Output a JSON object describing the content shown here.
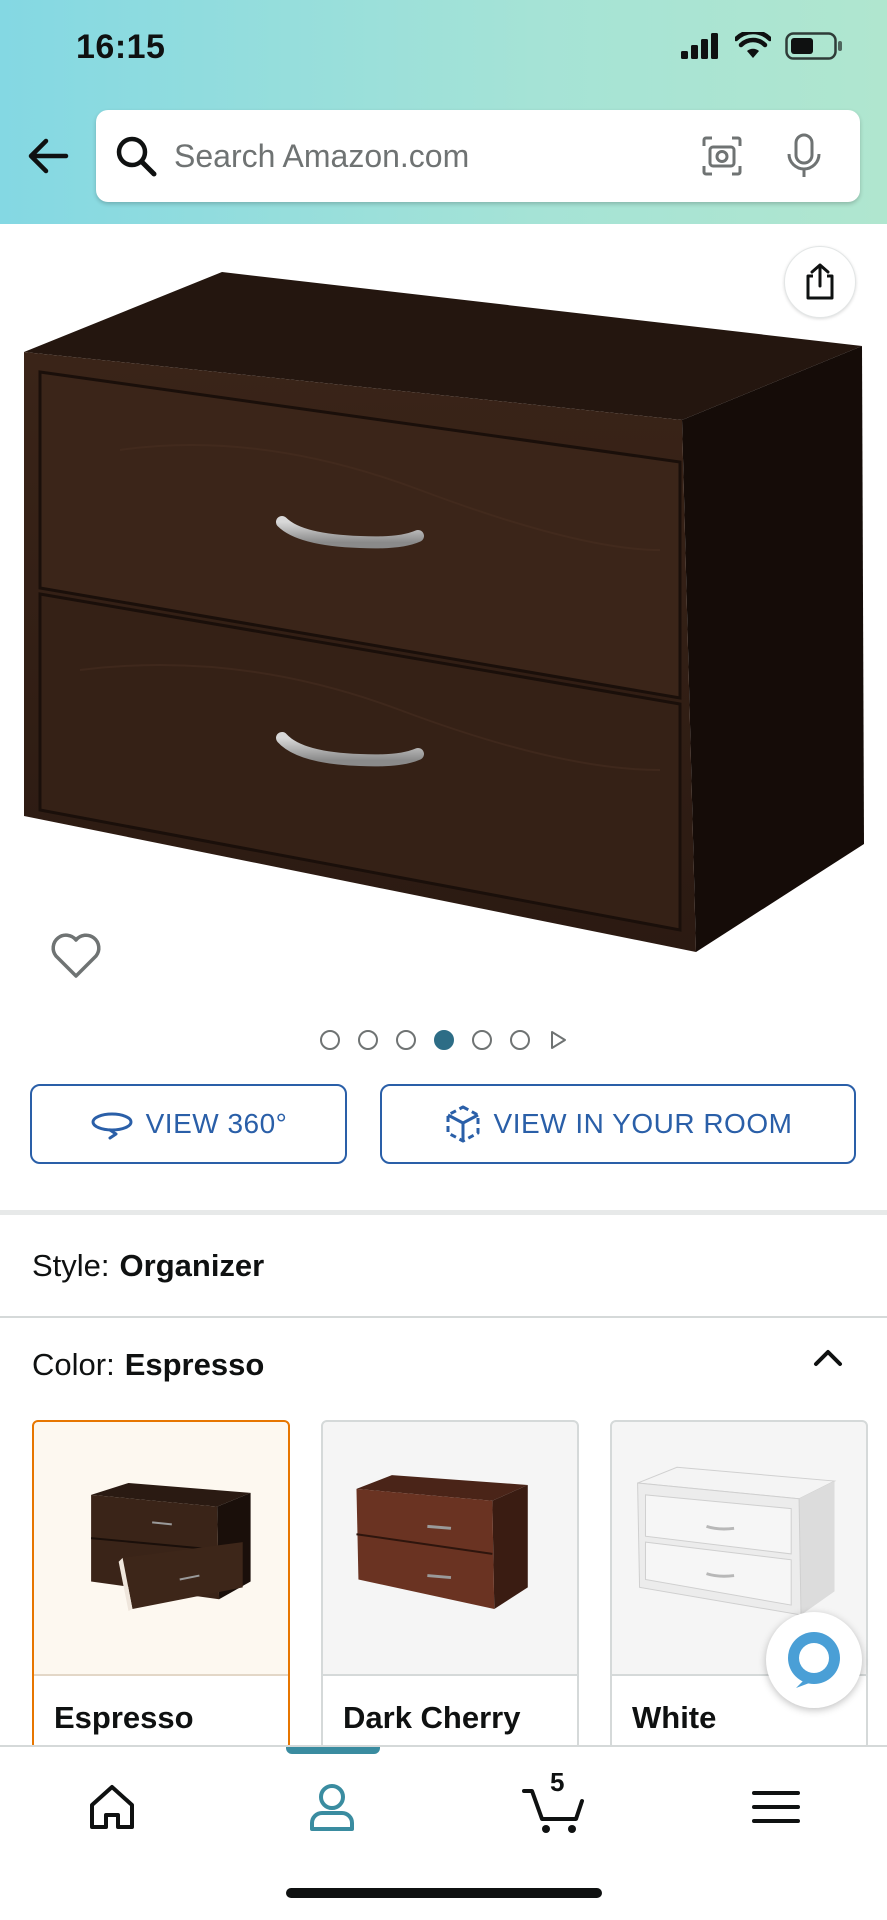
{
  "status_bar": {
    "time": "16:15"
  },
  "search": {
    "placeholder": "Search Amazon.com"
  },
  "carousel": {
    "dot_count": 6,
    "active_index": 3
  },
  "view_buttons": {
    "view_360": "VIEW 360°",
    "view_in_room": "VIEW IN YOUR ROOM"
  },
  "style": {
    "label": "Style:",
    "value": "Organizer"
  },
  "color": {
    "label": "Color:",
    "value": "Espresso"
  },
  "swatches": [
    {
      "name": "Espresso",
      "selected": true,
      "color": "#3a2418"
    },
    {
      "name": "Dark Cherry",
      "selected": false,
      "color": "#5a2a1c"
    },
    {
      "name": "White",
      "selected": false,
      "color": "#e8e8e8"
    }
  ],
  "bottom_nav": {
    "cart_count": "5"
  },
  "colors": {
    "accent_link": "#2a5fa8",
    "selected_swatch_border": "#e77600",
    "active_nav": "#3a8ca0"
  }
}
